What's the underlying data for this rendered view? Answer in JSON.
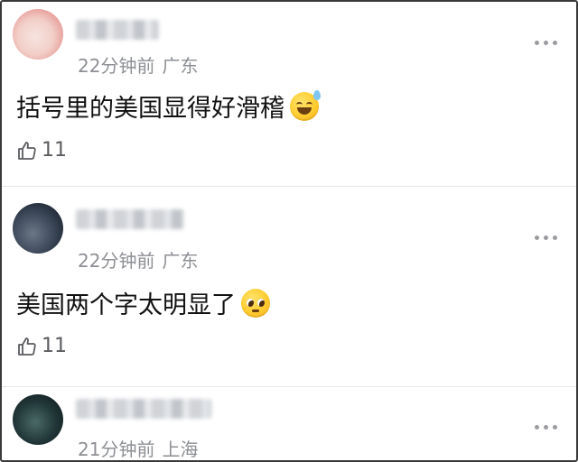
{
  "comments": [
    {
      "time": "22分钟前",
      "location": "广东",
      "text": "括号里的美国显得好滑稽",
      "emoji": "grinning-sweat-emoji",
      "likes": "11"
    },
    {
      "time": "22分钟前",
      "location": "广东",
      "text": "美国两个字太明显了",
      "emoji": "pleading-face-emoji",
      "likes": "11"
    },
    {
      "time": "21分钟前",
      "location": "上海"
    }
  ]
}
